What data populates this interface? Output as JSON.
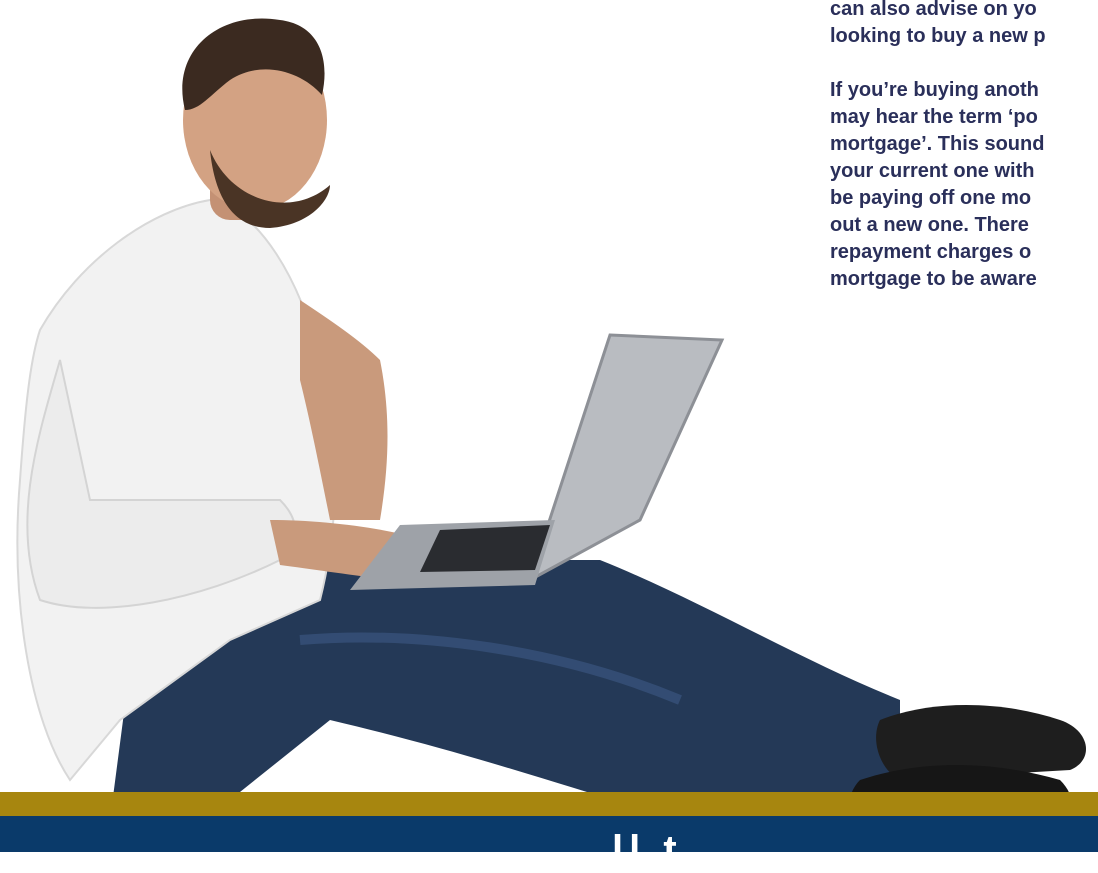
{
  "paragraph1": {
    "lines": [
      "can also advise on yo",
      "looking to buy a new p"
    ]
  },
  "paragraph2": {
    "lines": [
      "If you’re buying anoth",
      "may hear the term ‘po",
      "mortgage’. This sound",
      "your current one with",
      "be paying off one mo",
      "out a new one. There",
      "repayment charges o",
      "mortgage to be aware"
    ]
  },
  "footer": {
    "partial_text": "ll                    t"
  },
  "colors": {
    "text": "#2a2f5a",
    "gold": "#a7860f",
    "navy": "#0a3a6a"
  },
  "image": {
    "subject": "man-with-laptop"
  }
}
